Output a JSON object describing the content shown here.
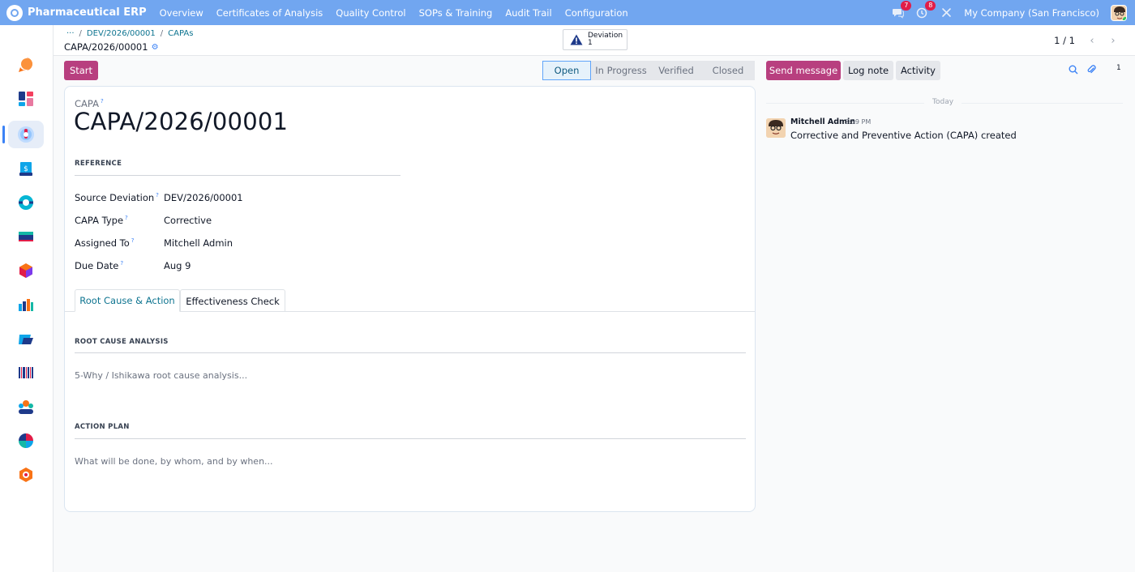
{
  "navbar": {
    "app_name": "Pharmaceutical ERP",
    "menu": [
      "Overview",
      "Certificates of Analysis",
      "Quality Control",
      "SOPs & Training",
      "Audit Trail",
      "Configuration"
    ],
    "messages_count": "7",
    "activities_count": "8",
    "company": "My Company (San Francisco)"
  },
  "breadcrumb": {
    "ellipsis": "···",
    "items": [
      "DEV/2026/00001",
      "CAPAs"
    ],
    "current": "CAPA/2026/00001"
  },
  "smart_button": {
    "label": "Deviation",
    "count": "1"
  },
  "pager": {
    "value": "1 / 1"
  },
  "actions": {
    "start": "Start"
  },
  "statusbar": {
    "stages": [
      "Open",
      "In Progress",
      "Verified",
      "Closed"
    ],
    "current": "Open"
  },
  "form": {
    "record_label": "CAPA",
    "help_mark": "?",
    "name": "CAPA/2026/00001",
    "reference_title": "REFERENCE",
    "fields": [
      {
        "label": "Source Deviation",
        "value": "DEV/2026/00001"
      },
      {
        "label": "CAPA Type",
        "value": "Corrective"
      },
      {
        "label": "Assigned To",
        "value": "Mitchell Admin"
      },
      {
        "label": "Due Date",
        "value": "Aug 9"
      }
    ],
    "tabs": [
      "Root Cause & Action",
      "Effectiveness Check"
    ],
    "root_cause_title": "ROOT CAUSE ANALYSIS",
    "root_cause_placeholder": "5-Why / Ishikawa root cause analysis...",
    "action_plan_title": "ACTION PLAN",
    "action_plan_placeholder": "What will be done, by whom, and by when..."
  },
  "chatter": {
    "send_message": "Send message",
    "log_note": "Log note",
    "activity": "Activity",
    "attachments_count": "1",
    "date_separator": "Today",
    "message": {
      "author": "Mitchell Admin",
      "time": "3:59 PM",
      "body": "Corrective and Preventive Action (CAPA) created"
    }
  },
  "colors": {
    "navbar": "#71a6f0",
    "primary_button": "#b83f7f",
    "link": "#0e7490"
  }
}
